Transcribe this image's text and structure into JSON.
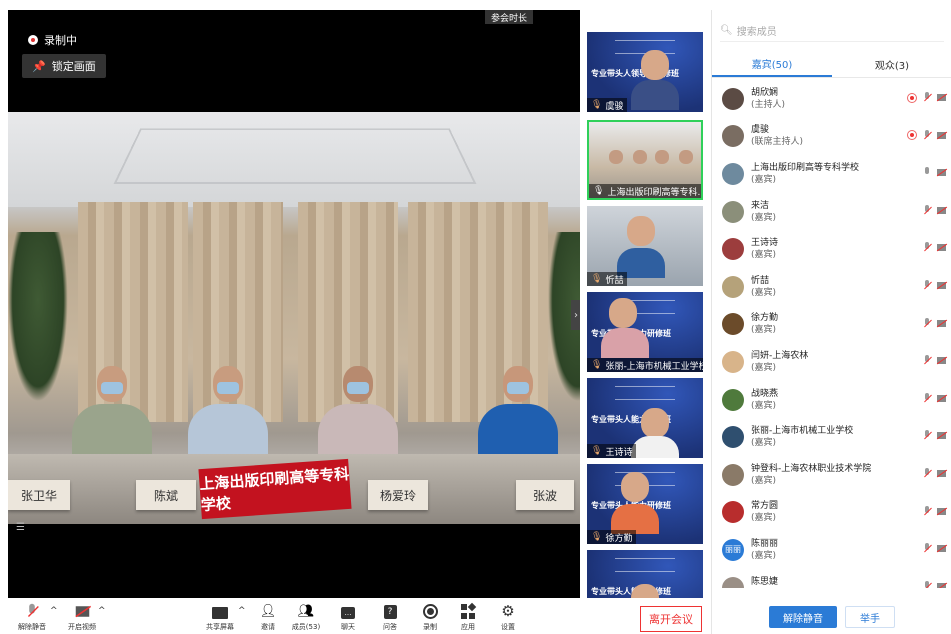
{
  "stage": {
    "recording_label": "录制中",
    "lock_label": "锁定画面",
    "timer_label": "参会时长",
    "nameplates": [
      "张卫华",
      "陈斌",
      "杨爱玲",
      "张波"
    ],
    "banner_text": "上海出版印刷高等专科学校"
  },
  "thumbnails": [
    {
      "label": "虞骏",
      "slide_title": "专业带头人领导力研修班"
    },
    {
      "label": "上海出版印刷高等专科...",
      "slide_title": ""
    },
    {
      "label": "忻喆",
      "slide_title": ""
    },
    {
      "label": "张丽-上海市机械工业学校",
      "slide_title": "专业带头人能力研修班"
    },
    {
      "label": "王诗诗",
      "slide_title": "专业带头人能力研修班"
    },
    {
      "label": "徐方勤",
      "slide_title": "专业带头人能力研修班"
    },
    {
      "label": "",
      "slide_title": "专业带头人能力研修班"
    }
  ],
  "panel": {
    "search_placeholder": "搜索成员",
    "tabs": [
      {
        "label": "嘉宾(50)",
        "active": true
      },
      {
        "label": "观众(3)",
        "active": false
      }
    ],
    "members": [
      {
        "name": "胡欣娴",
        "role": "(主持人)",
        "color": "#5b4b44",
        "rec": true
      },
      {
        "name": "虞骏",
        "role": "(联席主持人)",
        "color": "#7a6d62",
        "rec": true
      },
      {
        "name": "上海出版印刷高等专科学校",
        "role": "(嘉宾)",
        "color": "#6e8a9e",
        "rec": false
      },
      {
        "name": "来洁",
        "role": "(嘉宾)",
        "color": "#8b8f7a",
        "rec": false
      },
      {
        "name": "王诗诗",
        "role": "(嘉宾)",
        "color": "#9c3d3d",
        "rec": false
      },
      {
        "name": "忻喆",
        "role": "(嘉宾)",
        "color": "#b5a27a",
        "rec": false
      },
      {
        "name": "徐方勤",
        "role": "(嘉宾)",
        "color": "#6b4b2a",
        "rec": false
      },
      {
        "name": "闫妍-上海农林",
        "role": "(嘉宾)",
        "color": "#d8b48a",
        "rec": false
      },
      {
        "name": "战晓燕",
        "role": "(嘉宾)",
        "color": "#4f7a3c",
        "rec": false
      },
      {
        "name": "张丽-上海市机械工业学校",
        "role": "(嘉宾)",
        "color": "#2f4f6f",
        "rec": false
      },
      {
        "name": "钟登科-上海农林职业技术学院",
        "role": "(嘉宾)",
        "color": "#8a7a68",
        "rec": false
      },
      {
        "name": "常方圆",
        "role": "(嘉宾)",
        "color": "#b82d2d",
        "rec": false
      },
      {
        "name": "陈丽丽",
        "role": "(嘉宾)",
        "color": "#2b7bd6",
        "avatar_text": "丽丽",
        "rec": false
      },
      {
        "name": "陈思婕",
        "role": "(嘉宾)",
        "color": "#9a8f86",
        "rec": false
      }
    ],
    "unmute_label": "解除静音",
    "raise_hand_label": "举手"
  },
  "toolbar": {
    "unmute": "解除静音",
    "start_video": "开启视频",
    "share_screen": "共享屏幕",
    "invite": "邀请",
    "members": "成员(53)",
    "chat": "聊天",
    "qa": "问答",
    "record": "录制",
    "apps": "应用",
    "settings": "设置",
    "leave": "离开会议"
  }
}
